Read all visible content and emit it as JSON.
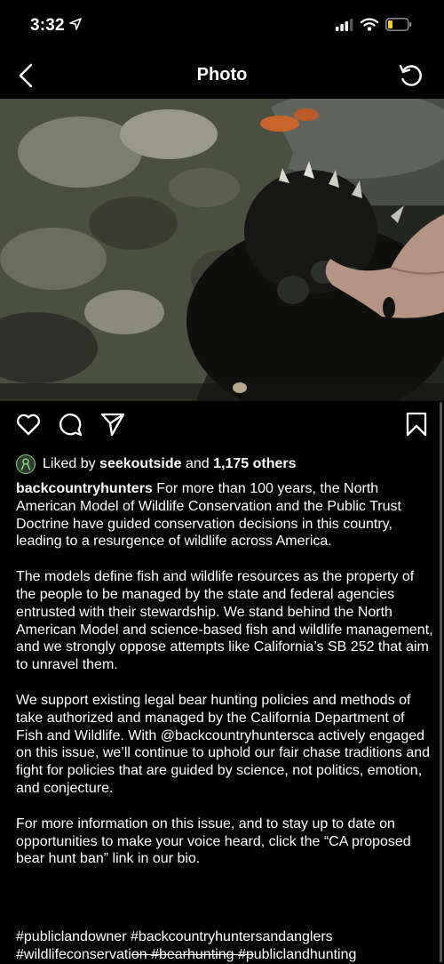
{
  "status": {
    "time": "3:32"
  },
  "nav": {
    "title": "Photo"
  },
  "likes": {
    "prefix": "Liked by ",
    "user": "seekoutside",
    "middle": " and ",
    "count": "1,175 others"
  },
  "caption": {
    "username": "backcountryhunters",
    "p1": " For more than 100 years, the North American Model of Wildlife Conservation and the Public Trust Doctrine have guided conservation decisions in this country, leading to a resurgence of wildlife across America.",
    "p2": "The models define fish and wildlife resources as the property of the people to be managed by the state and federal agencies entrusted with their stewardship. We stand behind the North American Model and science-based fish and wildlife management, and we strongly oppose attempts like California’s SB 252 that aim to unravel them.",
    "p3": "We support existing legal bear hunting policies and methods of take authorized and managed by the California Department of Fish and Wildlife. With @backcountryhuntersca actively engaged on this issue, we’ll continue to uphold our fair chase traditions and fight for policies that are guided by science, not politics, emotion, and conjecture.",
    "p4": "For more information on this issue, and to stay up to date on opportunities to make your voice heard, click the “CA proposed bear hunt ban” link in our bio."
  },
  "hashtags": {
    "line1": "#publiclandowner #backcountryhuntersandanglers",
    "line2a": "#wildlifeconservati",
    "line2b": "on #bearhunting #p",
    "line2c": "ubliclandhunting"
  },
  "icons": {
    "back": "chevron-left-icon",
    "refresh": "refresh-icon",
    "like": "heart-icon",
    "comment": "comment-icon",
    "share": "send-icon",
    "save": "bookmark-icon"
  }
}
